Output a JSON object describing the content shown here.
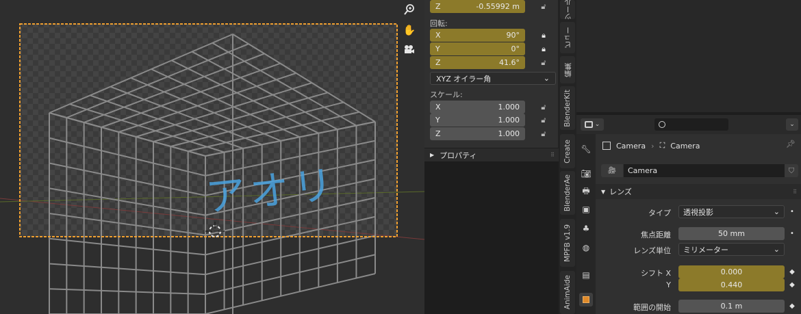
{
  "npanel": {
    "loc_z": {
      "axis": "Z",
      "value": "-0.55992 m"
    },
    "rotation_label": "回転:",
    "rotation": [
      {
        "axis": "X",
        "value": "90°"
      },
      {
        "axis": "Y",
        "value": "0°"
      },
      {
        "axis": "Z",
        "value": "41.6°"
      }
    ],
    "rotation_mode": "XYZ オイラー角",
    "scale_label": "スケール:",
    "scale": [
      {
        "axis": "X",
        "value": "1.000"
      },
      {
        "axis": "Y",
        "value": "1.000"
      },
      {
        "axis": "Z",
        "value": "1.000"
      }
    ],
    "properties_label": "プロパティ"
  },
  "vtabs": {
    "tab0": "ツール",
    "tab1": "ビュー",
    "tab2": "編集",
    "tab3": "BlenderKit",
    "tab4": "Create",
    "tab5": "BlenderAe",
    "tab6": "MPFB v1.9",
    "tab7": "AnimAide"
  },
  "viewport": {
    "annotation": "アオリ"
  },
  "props": {
    "breadcrumb_object": "Camera",
    "breadcrumb_data": "Camera",
    "datablock_name": "Camera",
    "section_title": "レンズ",
    "type_label": "タイプ",
    "type_value": "透視投影",
    "focal_label": "焦点距離",
    "focal_value": "50 mm",
    "lens_unit_label": "レンズ単位",
    "lens_unit_value": "ミリメーター",
    "shift_x_label": "シフト X",
    "shift_x_value": "0.000",
    "shift_y_label": "Y",
    "shift_y_value": "0.440",
    "clip_start_label": "範囲の開始",
    "clip_start_value": "0.1 m"
  },
  "colors": {
    "animated_field": "#8c7a2a",
    "camera_frame": "#f0a030",
    "annotation": "#4aa3e0"
  }
}
